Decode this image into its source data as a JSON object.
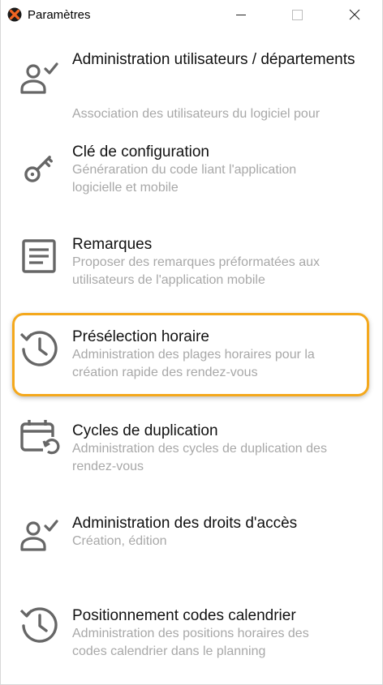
{
  "window": {
    "title": "Paramètres",
    "app_icon": "app-logo-icon",
    "controls": {
      "minimize": "minimize-icon",
      "maximize": "maximize-icon",
      "close": "close-icon"
    }
  },
  "colors": {
    "highlight": "#f4a81c",
    "title_text": "#111111",
    "desc_text": "#a8a8a8",
    "icon": "#666666"
  },
  "items": [
    {
      "icon": "user-check-icon",
      "title": "Administration utilisateurs / départements",
      "desc": "Association des utilisateurs du logiciel pour"
    },
    {
      "icon": "key-icon",
      "title": "Clé de configuration",
      "desc": "Généraration du code liant l'application logicielle et mobile"
    },
    {
      "icon": "document-icon",
      "title": "Remarques",
      "desc": "Proposer des remarques préformatées aux utilisateurs de l'application mobile"
    },
    {
      "icon": "history-clock-icon",
      "title": "Présélection horaire",
      "desc": "Administration des plages horaires pour la création rapide des rendez-vous",
      "highlighted": true
    },
    {
      "icon": "calendar-sync-icon",
      "title": "Cycles de duplication",
      "desc": "Administration des cycles de duplication des rendez-vous"
    },
    {
      "icon": "user-check-icon",
      "title": "Administration des droits d'accès",
      "desc": "Création, édition"
    },
    {
      "icon": "history-clock-icon",
      "title": "Positionnement codes calendrier",
      "desc": "Administration des positions horaires des codes calendrier dans le planning"
    }
  ]
}
